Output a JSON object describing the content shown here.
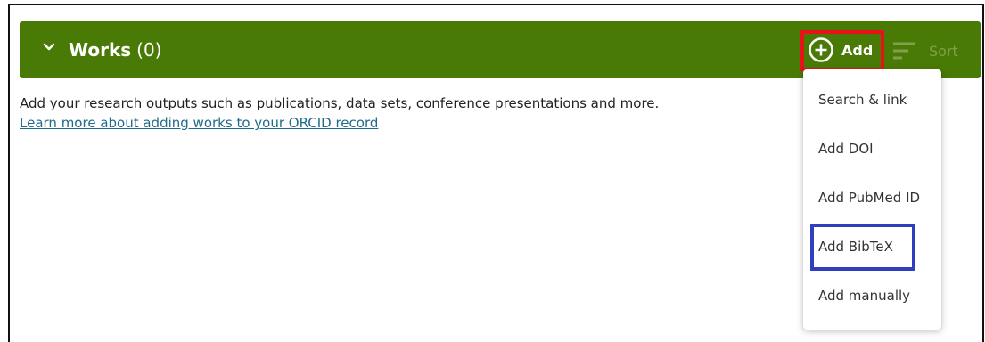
{
  "works": {
    "title": "Works",
    "count": "(0)",
    "add_label": "Add",
    "sort_label": "Sort",
    "description": "Add your research outputs such as publications, data sets, conference presentations and more.",
    "learn_more": "Learn more about adding works to your ORCID record"
  },
  "add_menu": {
    "items": [
      "Search & link",
      "Add DOI",
      "Add PubMed ID",
      "Add BibTeX",
      "Add manually"
    ]
  },
  "colors": {
    "header_bg": "#4a7a06",
    "highlight_add": "#e8121b",
    "highlight_bibtex": "#2f3fbf",
    "link": "#1f6b8a"
  },
  "icons": {
    "expand": "chevron-down-icon",
    "add": "plus-circle-icon",
    "sort": "sort-lines-icon"
  }
}
